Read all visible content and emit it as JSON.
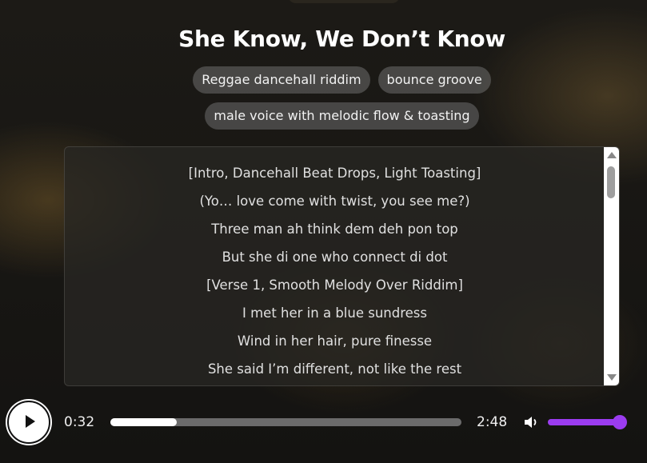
{
  "song": {
    "title": "She Know, We Don’t Know"
  },
  "tags": [
    "Reggae dancehall riddim",
    "bounce groove",
    "male voice with melodic flow & toasting"
  ],
  "lyrics": [
    "[Intro, Dancehall Beat Drops, Light Toasting]",
    "(Yo… love come with twist, you see me?)",
    "Three man ah think dem deh pon top",
    "But she di one who connect di dot",
    "[Verse 1, Smooth Melody Over Riddim]",
    "I met her in a blue sundress",
    "Wind in her hair, pure finesse",
    "She said I’m different, not like the rest"
  ],
  "player": {
    "current_time": "0:32",
    "duration": "2:48",
    "progress": 0.19,
    "volume": 1.0,
    "play_icon": "play-icon",
    "volume_icon": "volume-icon",
    "accent_color": "#9b3cf0"
  }
}
